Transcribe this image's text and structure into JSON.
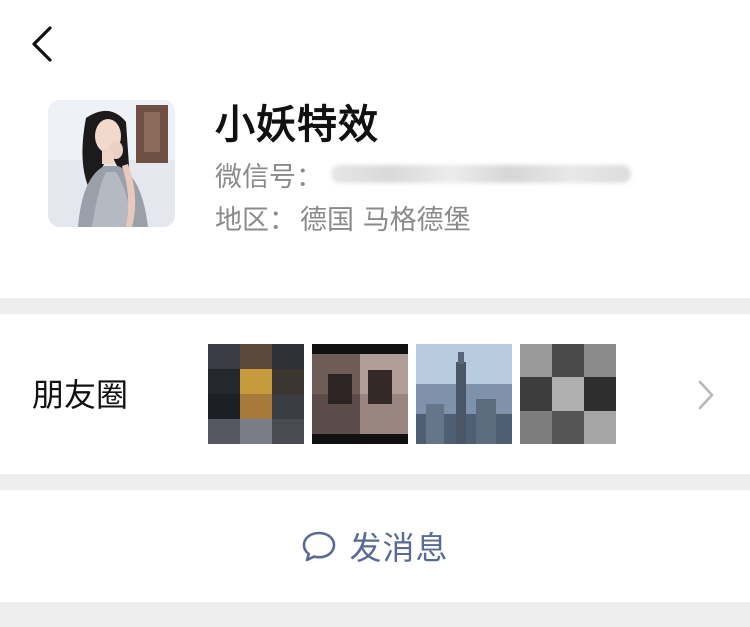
{
  "navigation": {
    "back_icon": "chevron-left-icon"
  },
  "profile": {
    "nickname": "小妖特效",
    "wechat_id_label": "微信号：",
    "wechat_id_value_blurred": true,
    "region_label": "地区：",
    "region_value": "德国 马格德堡",
    "avatar_icon": "avatar-photo"
  },
  "moments": {
    "label": "朋友圈",
    "thumbnails": [
      {
        "name": "moment-thumb-1",
        "pixelated": true
      },
      {
        "name": "moment-thumb-2",
        "pixelated": true
      },
      {
        "name": "moment-thumb-3",
        "pixelated": true
      },
      {
        "name": "moment-thumb-4",
        "pixelated": true
      }
    ],
    "chevron_icon": "chevron-right-icon"
  },
  "actions": {
    "send_message_label": "发消息",
    "send_message_icon": "chat-bubble-icon"
  },
  "colors": {
    "link_blue": "#576b95",
    "secondary_text": "#8a8a8a",
    "primary_text": "#111111",
    "separator": "#ededed"
  }
}
